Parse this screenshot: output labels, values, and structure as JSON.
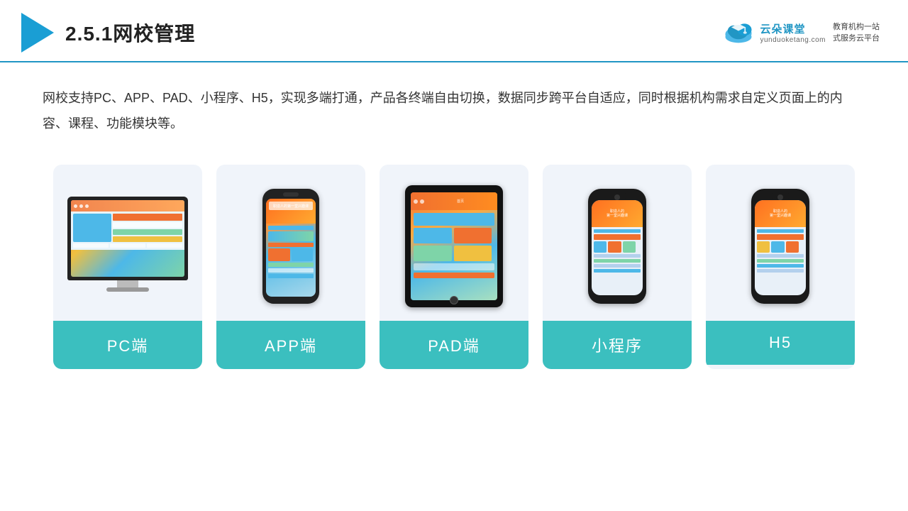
{
  "header": {
    "title": "2.5.1网校管理",
    "brand": {
      "name": "云朵课堂",
      "url": "yunduoketang.com",
      "slogan": "教育机构一站\n式服务云平台"
    }
  },
  "description": "网校支持PC、APP、PAD、小程序、H5，实现多端打通，产品各终端自由切换，数据同步跨平台自适应，同时根据机构需求自定义页面上的内容、课程、功能模块等。",
  "cards": [
    {
      "id": "pc",
      "label": "PC端",
      "device": "pc"
    },
    {
      "id": "app",
      "label": "APP端",
      "device": "phone"
    },
    {
      "id": "pad",
      "label": "PAD端",
      "device": "tablet"
    },
    {
      "id": "miniapp",
      "label": "小程序",
      "device": "mini-phone"
    },
    {
      "id": "h5",
      "label": "H5",
      "device": "mini-phone2"
    }
  ],
  "colors": {
    "accent": "#2196c4",
    "card_bg": "#f0f4fa",
    "card_label_bg": "#3bbfbf",
    "title_color": "#222"
  }
}
